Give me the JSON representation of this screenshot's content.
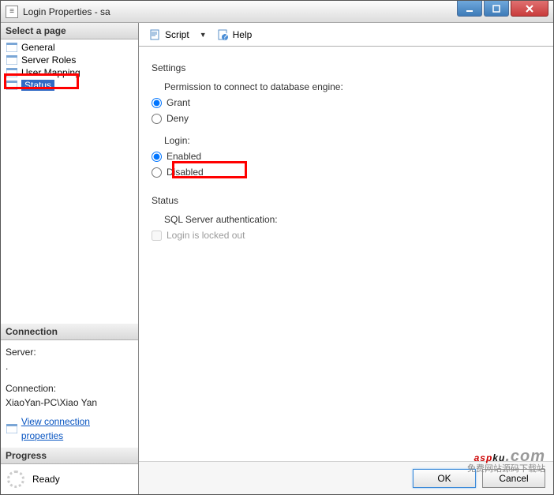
{
  "window": {
    "title": "Login Properties - sa"
  },
  "sidebar": {
    "header": "Select a page",
    "items": [
      {
        "label": "General"
      },
      {
        "label": "Server Roles"
      },
      {
        "label": "User Mapping"
      },
      {
        "label": "Status"
      }
    ]
  },
  "toolbar": {
    "script_label": "Script",
    "help_label": "Help"
  },
  "settings": {
    "heading": "Settings",
    "permission_label": "Permission to connect to database engine:",
    "grant_label": "Grant",
    "deny_label": "Deny",
    "login_label": "Login:",
    "enabled_label": "Enabled",
    "disabled_label": "Disabled"
  },
  "status": {
    "heading": "Status",
    "auth_label": "SQL Server authentication:",
    "locked_label": "Login is locked out"
  },
  "connection": {
    "header": "Connection",
    "server_label": "Server:",
    "server_value": ".",
    "conn_label": "Connection:",
    "conn_value": "XiaoYan-PC\\Xiao Yan",
    "link_label": "View connection properties"
  },
  "progress": {
    "header": "Progress",
    "ready_label": "Ready"
  },
  "footer": {
    "ok_label": "OK",
    "cancel_label": "Cancel"
  },
  "watermark": {
    "brand_a": "asp",
    "brand_b": "ku",
    "brand_c": ".com",
    "tagline": "免费网站源码下载站"
  }
}
